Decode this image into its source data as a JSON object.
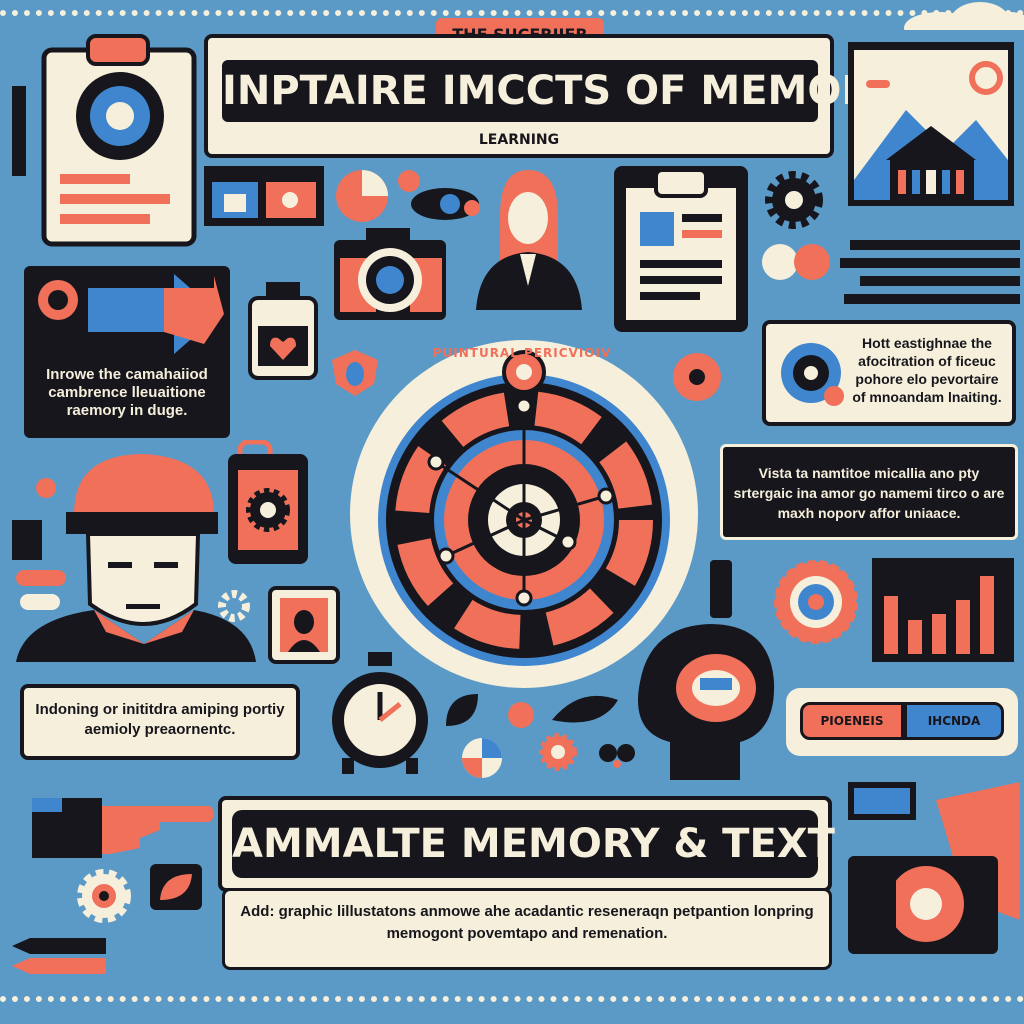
{
  "colors": {
    "background": "#5b9ac6",
    "ink": "#16161c",
    "cream": "#f6efdc",
    "coral": "#f0705a",
    "blue": "#3f86cf"
  },
  "header": {
    "tag": "THE SUCERIIER",
    "title": "INPTAIRE IMCCTS OF MEMORY",
    "subtitle": "LEARNING"
  },
  "left_top_box": {
    "text": "Inrowe the camahaiiod cambrence lleuaitione raemory in duge."
  },
  "right_top_box": {
    "text": "Hott eastighnae the afocitration of ficeuc pohore elo pevortaire of mnoandam lnaiting."
  },
  "right_mid_box": {
    "text": "Vista ta namtitoe micallia ano pty srtergaic ina amor go namemi tirco o are maxh noporv affor uniaace."
  },
  "circle": {
    "label": "PUINTURAL PERICVIOIV"
  },
  "left_bottom_box": {
    "text": "Indoning or inititdra amiping portiy aemioly preaornentc."
  },
  "toggle": {
    "left": "PIOENEIS",
    "right": "IHCNDA"
  },
  "banner": {
    "title": "AMMALTE MEMORY & TEXT"
  },
  "footnote": {
    "text": "Add: graphic lillustatons anmowe ahe acadantic reseneraqn petpantion lonpring memogont povemtapo and remenation."
  },
  "icons": [
    "clipboard-icon",
    "gear-icon",
    "arrow-icon",
    "camera-icon",
    "pie-icon",
    "person-icon",
    "document-icon",
    "pencil-icon",
    "bottle-icon",
    "building-icon",
    "phone-icon",
    "stopwatch-icon",
    "bar-chart-icon",
    "head-icon",
    "hand-icon",
    "monitor-icon"
  ]
}
